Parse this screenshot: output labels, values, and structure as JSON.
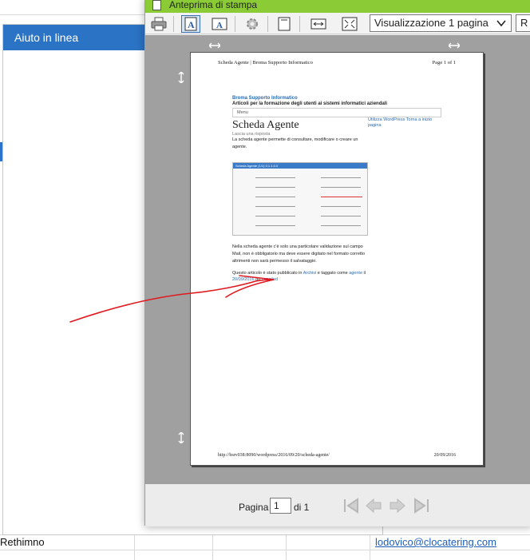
{
  "spreadsheet": {
    "left_cell_text": "Rethimno",
    "email": "lodovico@clocatering.com"
  },
  "help_panel": {
    "title": "Aiuto in linea"
  },
  "preview_window": {
    "title": "Anteprima di stampa",
    "toolbar": {
      "print_icon": "printer-icon",
      "view_select_value": "Visualizzazione 1 pagina",
      "cut_select_value": "R"
    },
    "page": {
      "header_left": "Scheda Agente | Broma Supporto Informatico",
      "header_right": "Page 1 of 1",
      "blog_name": "Broma Supporto Informatico",
      "blog_tagline": "Articoli per la formazione degli utenti ai sistemi informatici aziendali",
      "menu_label": "Menu",
      "post_title": "Scheda Agente",
      "reply": "Lascia una risposta",
      "sidebar_links": "Utilizza WordPress Torna a inizio pagina",
      "intro": "La scheda agente permette di consultare, modificare o creare un agente.",
      "shot_title": "Scheda Agente (1/1) 0.1.1.0.0",
      "body": "Nella scheda agente c'è solo una particolare validazione sul campo Mail, non è obbligatorio ma deve essere digitato nel formato corretto altrimenti non sarà permesso il salvataggio.",
      "meta_prefix": "Questo articolo è stato pubblicato in",
      "meta_category": "Archivi",
      "meta_mid": "e taggato come",
      "meta_tag": "agente",
      "meta_date_prefix": "il",
      "meta_date": "20/09/2016",
      "meta_by": "da",
      "meta_author": "consilod",
      "footer_left": "http://bsrv038:8090/wordpress/2016/09/20/scheda-agente/",
      "footer_right": "20/09/2016"
    },
    "pager": {
      "label": "Pagina",
      "current": "1",
      "of_label": "di 1"
    }
  },
  "annotation": {
    "color": "#e0191e"
  }
}
